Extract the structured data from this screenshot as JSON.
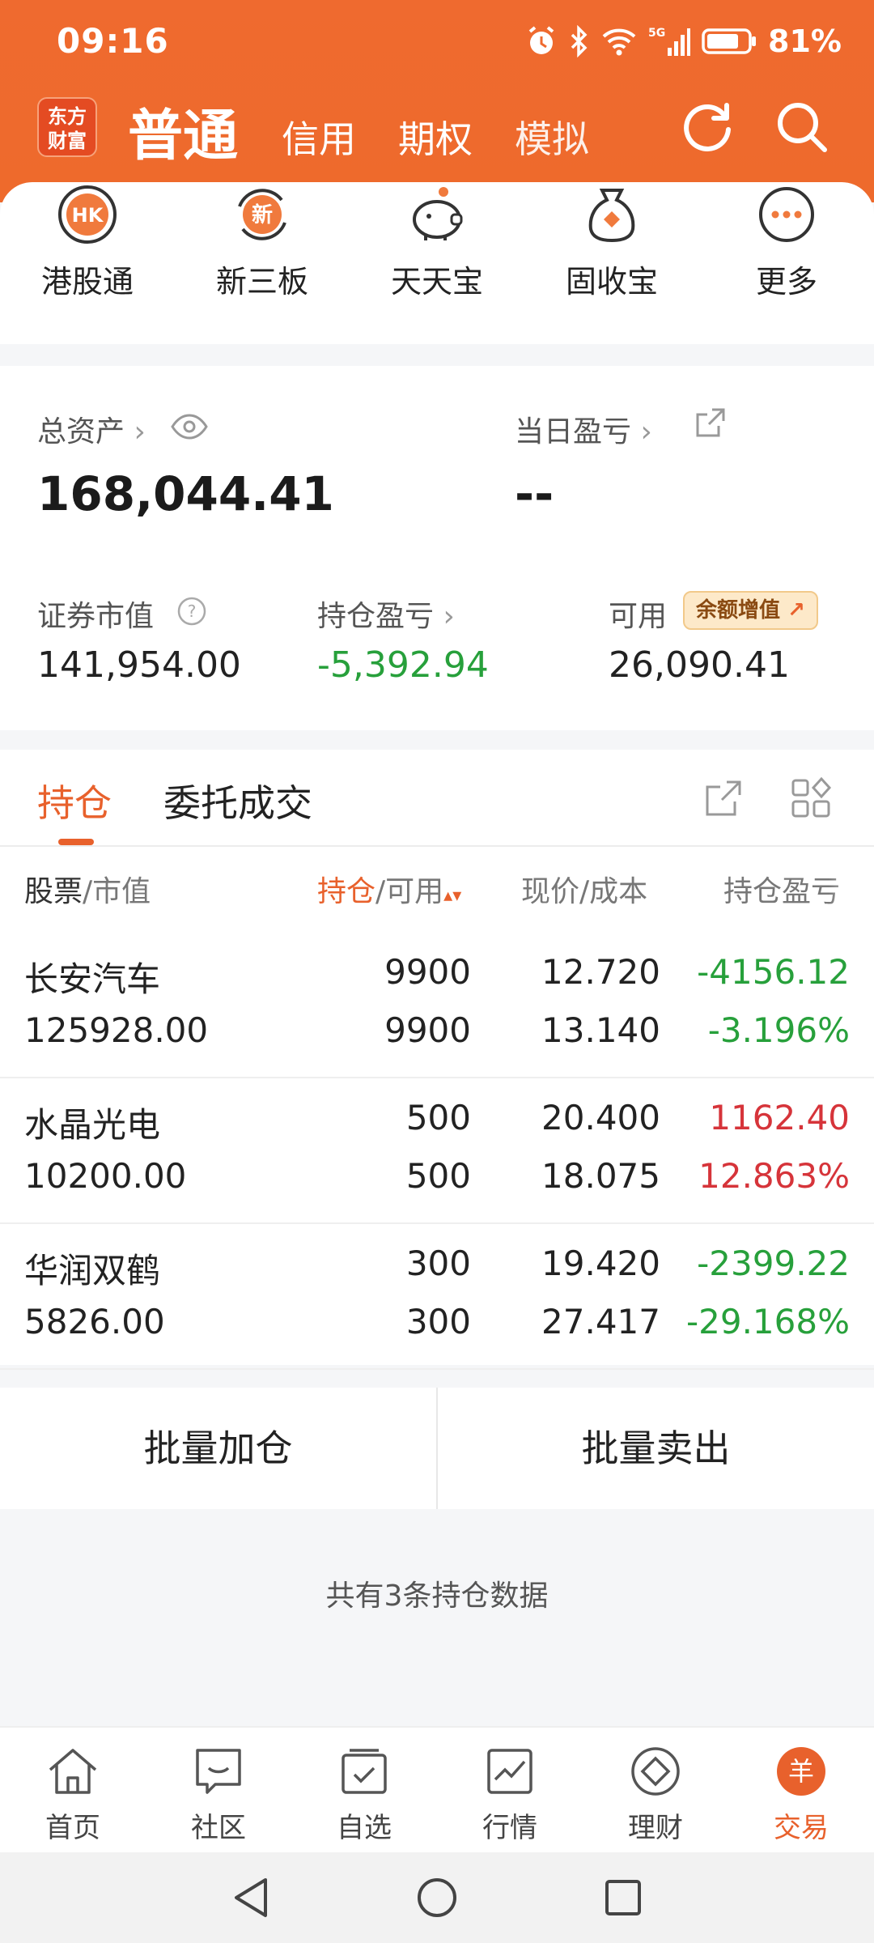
{
  "status_bar": {
    "time": "09:16",
    "network": "5G",
    "battery": "81%"
  },
  "header": {
    "logo_line1": "东方",
    "logo_line2": "财富",
    "tabs": [
      {
        "label": "普通"
      },
      {
        "label": "信用"
      },
      {
        "label": "期权"
      },
      {
        "label": "模拟"
      }
    ]
  },
  "quick_actions": [
    {
      "label": "港股通",
      "icon": "hk-icon",
      "icon_text": "HK"
    },
    {
      "label": "新三板",
      "icon": "xin-icon",
      "icon_text": "新"
    },
    {
      "label": "天天宝",
      "icon": "piggy-bank-icon"
    },
    {
      "label": "固收宝",
      "icon": "money-bag-icon"
    },
    {
      "label": "更多",
      "icon": "more-icon"
    }
  ],
  "assets": {
    "total_label": "总资产",
    "total_value": "168,044.41",
    "daily_pl_label": "当日盈亏",
    "daily_pl_value": "--",
    "market_value_label": "证券市值",
    "market_value": "141,954.00",
    "position_pl_label": "持仓盈亏",
    "position_pl_value": "-5,392.94",
    "available_label": "可用",
    "available_value": "26,090.41",
    "badge_label": "余额增值"
  },
  "positions": {
    "tabs": [
      "持仓",
      "委托成交"
    ],
    "columns": {
      "stock": "股票",
      "market_value": "/市值",
      "holding": "持仓",
      "available": "/可用",
      "price_cost": "现价/成本",
      "pl": "持仓盈亏"
    },
    "rows": [
      {
        "name": "长安汽车",
        "market_value": "125928.00",
        "holding": "9900",
        "available": "9900",
        "price": "12.720",
        "cost": "13.140",
        "pl": "-4156.12",
        "pl_pct": "-3.196%",
        "trend": "down"
      },
      {
        "name": "水晶光电",
        "market_value": "10200.00",
        "holding": "500",
        "available": "500",
        "price": "20.400",
        "cost": "18.075",
        "pl": "1162.40",
        "pl_pct": "12.863%",
        "trend": "up"
      },
      {
        "name": "华润双鹤",
        "market_value": "5826.00",
        "holding": "300",
        "available": "300",
        "price": "19.420",
        "cost": "27.417",
        "pl": "-2399.22",
        "pl_pct": "-29.168%",
        "trend": "down"
      }
    ]
  },
  "bulk_actions": {
    "add": "批量加仓",
    "sell": "批量卖出"
  },
  "footer_note": "共有3条持仓数据",
  "bottom_nav": [
    {
      "label": "首页",
      "icon": "home-icon"
    },
    {
      "label": "社区",
      "icon": "community-icon"
    },
    {
      "label": "自选",
      "icon": "watchlist-icon"
    },
    {
      "label": "行情",
      "icon": "market-icon"
    },
    {
      "label": "理财",
      "icon": "wealth-icon"
    },
    {
      "label": "交易",
      "icon": "trade-icon",
      "icon_text": "羊",
      "active": true
    }
  ],
  "colors": {
    "accent": "#e8612c",
    "header": "#ef6a2f",
    "up": "#d6343a",
    "down": "#27a03b"
  }
}
